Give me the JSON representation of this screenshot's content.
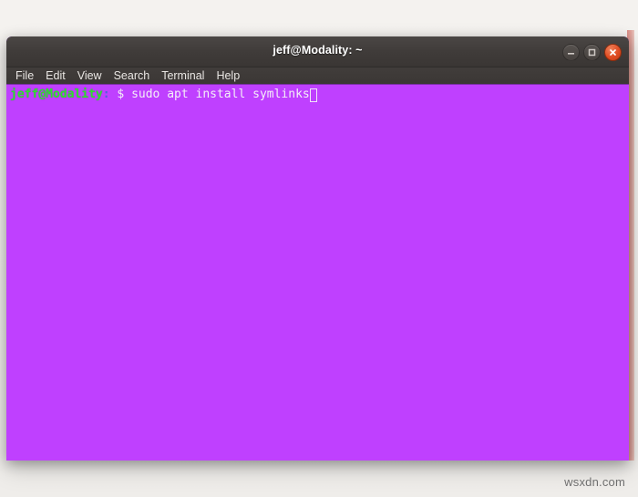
{
  "window": {
    "title": "jeff@Modality: ~",
    "controls": [
      {
        "name": "minimize",
        "glyph": "minimize-icon"
      },
      {
        "name": "maximize",
        "glyph": "maximize-icon"
      },
      {
        "name": "close",
        "glyph": "close-icon"
      }
    ],
    "close_color": "#df4a20"
  },
  "menubar": {
    "items": [
      {
        "label": "File"
      },
      {
        "label": "Edit"
      },
      {
        "label": "View"
      },
      {
        "label": "Search"
      },
      {
        "label": "Terminal"
      },
      {
        "label": "Help"
      }
    ]
  },
  "terminal": {
    "background_color": "#bf40ff",
    "prompt_user_host": "jeff@Modality",
    "prompt_colon": ":",
    "prompt_symbol": " $ ",
    "command": "sudo apt install symlinks",
    "cursor": "block-cursor",
    "prompt_color": "#2ee02e",
    "text_color": "#f4eef8"
  },
  "watermark": {
    "text": "wsxdn.com"
  }
}
